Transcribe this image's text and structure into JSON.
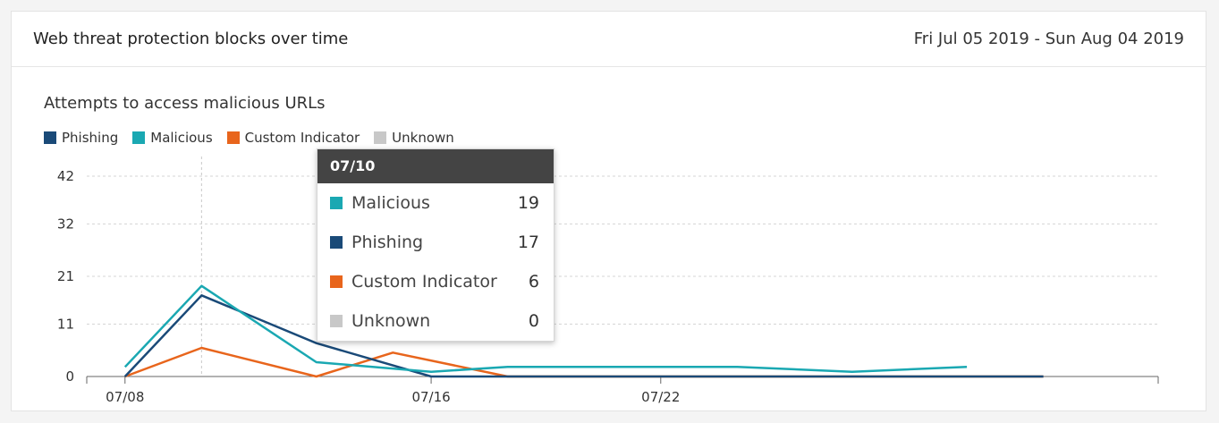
{
  "header": {
    "title": "Web threat protection blocks over time",
    "date_range": "Fri Jul 05 2019 - Sun Aug 04 2019"
  },
  "colors": {
    "phishing": "#1a4a78",
    "malicious": "#1aa8b2",
    "custom_indicator": "#e8651c",
    "unknown": "#c8c8c8"
  },
  "chart_data": {
    "type": "line",
    "title": "Attempts to access malicious URLs",
    "x": [
      "07/07",
      "07/08",
      "07/09",
      "07/10",
      "07/11",
      "07/12",
      "07/13",
      "07/14",
      "07/15",
      "07/16",
      "07/17",
      "07/18",
      "07/19",
      "07/20",
      "07/21",
      "07/22",
      "07/23",
      "07/24",
      "07/25",
      "07/26",
      "07/27",
      "07/28",
      "07/29",
      "07/30",
      "07/31",
      "08/01",
      "08/02",
      "08/03",
      "08/04"
    ],
    "x_tick_labels": [
      "07/08",
      "07/16",
      "07/22"
    ],
    "y_ticks": [
      0,
      11,
      21,
      32,
      42
    ],
    "ylim": [
      0,
      42
    ],
    "grid": true,
    "legend_position": "top-left",
    "series": [
      {
        "name": "Phishing",
        "key": "phishing",
        "points": [
          [
            "07/08",
            0
          ],
          [
            "07/10",
            17
          ],
          [
            "07/13",
            7
          ],
          [
            "07/16",
            0
          ],
          [
            "07/18",
            0
          ],
          [
            "08/01",
            0
          ]
        ]
      },
      {
        "name": "Malicious",
        "key": "malicious",
        "points": [
          [
            "07/08",
            2
          ],
          [
            "07/10",
            19
          ],
          [
            "07/13",
            3
          ],
          [
            "07/16",
            1
          ],
          [
            "07/18",
            2
          ],
          [
            "07/20",
            2
          ],
          [
            "07/22",
            2
          ],
          [
            "07/24",
            2
          ],
          [
            "07/27",
            1
          ],
          [
            "07/30",
            2
          ]
        ]
      },
      {
        "name": "Custom Indicator",
        "key": "custom_indicator",
        "points": [
          [
            "07/08",
            0
          ],
          [
            "07/10",
            6
          ],
          [
            "07/13",
            0
          ],
          [
            "07/15",
            5
          ],
          [
            "07/18",
            0
          ],
          [
            "08/01",
            0
          ]
        ]
      },
      {
        "name": "Unknown",
        "key": "unknown",
        "points": []
      }
    ]
  },
  "tooltip": {
    "date": "07/10",
    "rows": [
      {
        "label": "Malicious",
        "value": "19",
        "key": "malicious"
      },
      {
        "label": "Phishing",
        "value": "17",
        "key": "phishing"
      },
      {
        "label": "Custom Indicator",
        "value": "6",
        "key": "custom_indicator"
      },
      {
        "label": "Unknown",
        "value": "0",
        "key": "unknown"
      }
    ]
  }
}
